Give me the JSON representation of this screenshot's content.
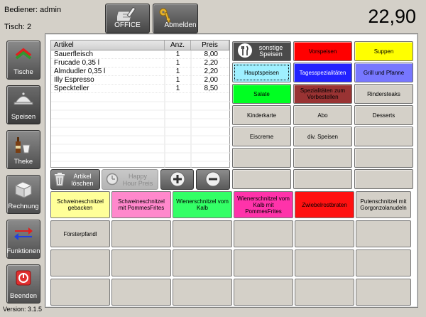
{
  "header": {
    "user": "Bediener: admin",
    "table": "Tisch: 2",
    "total": "22,90",
    "office_label": "OFFICE",
    "logout_label": "Abmelden"
  },
  "sidebar": {
    "items": [
      {
        "label": "Tische",
        "icon": "tables-icon"
      },
      {
        "label": "Speisen",
        "icon": "cloche-icon"
      },
      {
        "label": "Theke",
        "icon": "bottle-icon"
      },
      {
        "label": "Rechnung",
        "icon": "register-icon"
      },
      {
        "label": "Funktionen",
        "icon": "arrows-icon"
      },
      {
        "label": "Beenden",
        "icon": "power-icon"
      }
    ],
    "version": "Version: 3.1.5"
  },
  "order": {
    "columns": [
      "Artikel",
      "Anz.",
      "Preis"
    ],
    "rows": [
      {
        "name": "Sauerfleisch",
        "qty": "1",
        "price": "8,00"
      },
      {
        "name": "Frucade 0,35 l",
        "qty": "1",
        "price": "2,20"
      },
      {
        "name": "Almdudler 0,35 l",
        "qty": "1",
        "price": "2,20"
      },
      {
        "name": "Illy Espresso",
        "qty": "1",
        "price": "2,00"
      },
      {
        "name": "Speckteller",
        "qty": "1",
        "price": "8,50"
      }
    ]
  },
  "tools": {
    "delete_label": "Artikel löschen",
    "happy_hour_label": "Happy Hour Preis"
  },
  "categories": [
    {
      "label": "sonstige Speisen",
      "color": "#4a4a4a",
      "text": "#ffffff",
      "icon": "cutlery-icon"
    },
    {
      "label": "Vorspeisen",
      "color": "#ff0000",
      "text": "#000000"
    },
    {
      "label": "Suppen",
      "color": "#ffff00",
      "text": "#000000"
    },
    {
      "label": "Hauptspeisen",
      "color": "#9ff0ff",
      "text": "#000000"
    },
    {
      "label": "Tagesspezialitäten",
      "color": "#2222ff",
      "text": "#ffffff"
    },
    {
      "label": "Grill und Pfanne",
      "color": "#7777ff",
      "text": "#000000"
    },
    {
      "label": "Salate",
      "color": "#00ff22",
      "text": "#000000"
    },
    {
      "label": "Spezialitäten zum Vorbestellen",
      "color": "#993333",
      "text": "#000000"
    },
    {
      "label": "Rindersteaks",
      "color": "#d4d0c8",
      "text": "#000000"
    },
    {
      "label": "Kinderkarte",
      "color": "#d4d0c8",
      "text": "#000000"
    },
    {
      "label": "Abo",
      "color": "#d4d0c8",
      "text": "#000000"
    },
    {
      "label": "Desserts",
      "color": "#d4d0c8",
      "text": "#000000"
    },
    {
      "label": "Eiscreme",
      "color": "#d4d0c8",
      "text": "#000000"
    },
    {
      "label": "div. Speisen",
      "color": "#d4d0c8",
      "text": "#000000"
    }
  ],
  "products": [
    {
      "label": "Schweineschnitzel gebacken",
      "color": "#ffff99"
    },
    {
      "label": "Schweineschnitzel mit PommesFrites",
      "color": "#ff88cc"
    },
    {
      "label": "Wienerschnitzel vom Kalb",
      "color": "#33ff66"
    },
    {
      "label": "Wienerschnitzel vom Kalb mit PommesFrites",
      "color": "#ff33aa"
    },
    {
      "label": "Zwiebelrostbraten",
      "color": "#ff1111"
    },
    {
      "label": "Putenschnitzel mit Gorgonzolanudeln",
      "color": "#d4d0c8"
    },
    {
      "label": "Försterpfandl",
      "color": "#d4d0c8"
    }
  ]
}
